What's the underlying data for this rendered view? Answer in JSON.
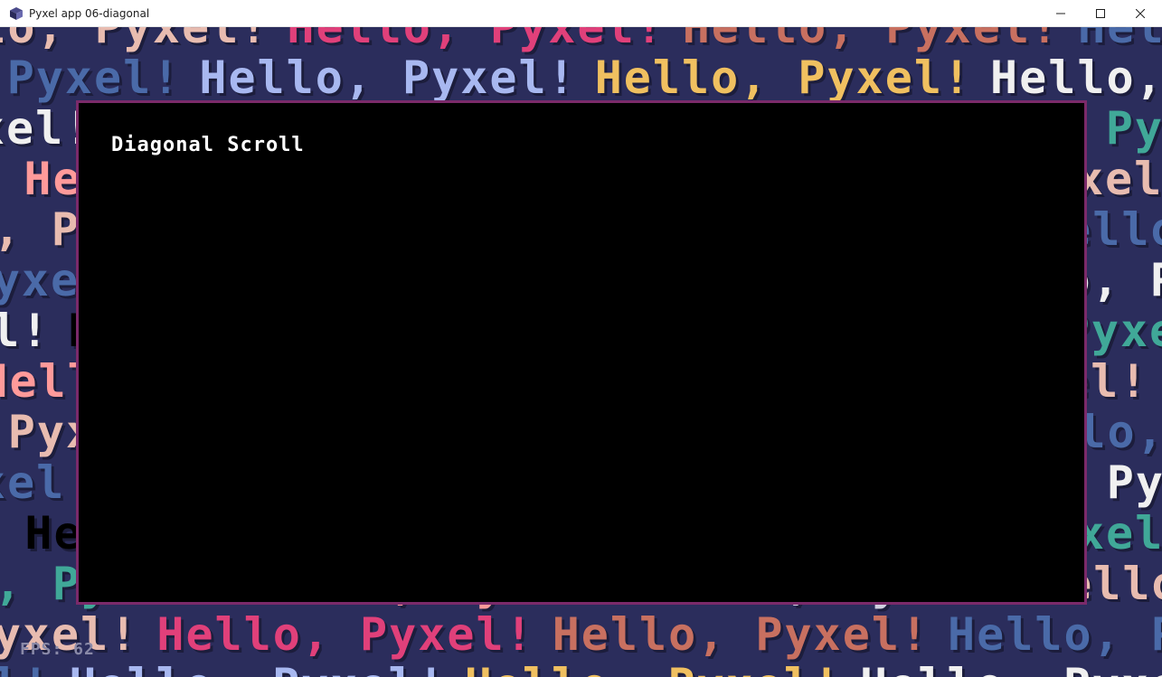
{
  "window": {
    "title": "Pyxel app 06-diagonal"
  },
  "game": {
    "panel_title": "Diagonal Scroll",
    "fps_label": "FPS: 62",
    "scroll_text": "Hello, Pyxel!",
    "background_color": "#2b2d5c",
    "panel_border_color": "#7b2a6a",
    "palette": [
      "#e8bcb0",
      "#e0407a",
      "#c87060",
      "#4a6aa8",
      "#a8b8f0",
      "#f0c060",
      "#f0f0f0",
      "#000000",
      "#e88a4a",
      "#40a898",
      "#ff9a9a",
      "#d0d0e0"
    ]
  },
  "icons": {
    "app": "pyxel-cube-icon",
    "minimize": "minimize-icon",
    "maximize": "maximize-icon",
    "close": "close-icon"
  }
}
